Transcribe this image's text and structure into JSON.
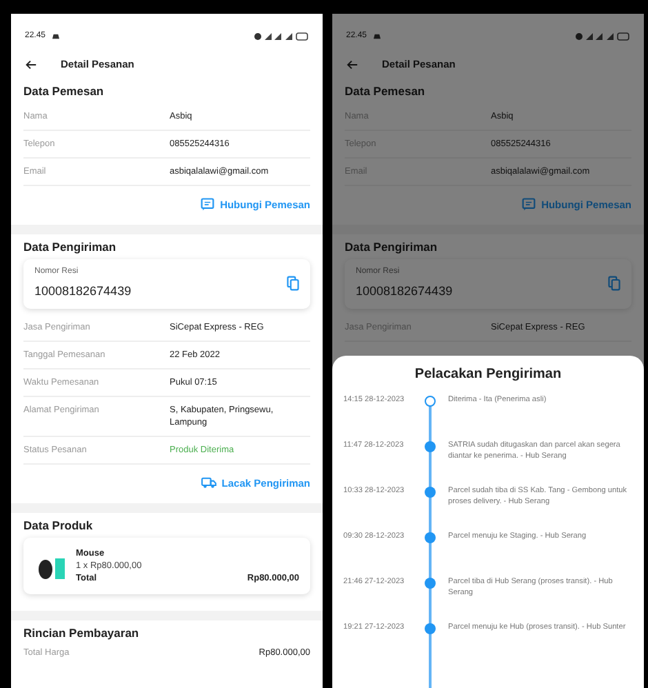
{
  "screens": [
    {
      "status_bar": {
        "time": "22.45"
      },
      "header": {
        "title": "Detail Pesanan"
      },
      "dimmed": false,
      "sections": [
        {
          "title": "Data Pemesan",
          "rows": [
            {
              "label": "Nama",
              "value": "Asbiq",
              "kind": "plain"
            },
            {
              "label": "Telepon",
              "value": "085525244316",
              "kind": "plain"
            },
            {
              "label": "Email",
              "value": "asbiqalalawi@gmail.com",
              "kind": "plain"
            }
          ],
          "action": {
            "label": "Hubungi Pemesan",
            "kind": "chat"
          }
        },
        {
          "title": "Data Pengiriman",
          "resi": {
            "label": "Nomor Resi",
            "value": "10008182674439"
          },
          "rows": [
            {
              "label": "Jasa Pengiriman",
              "value": "SiCepat Express - REG",
              "kind": "plain"
            },
            {
              "label": "Tanggal Pemesanan",
              "value": "22 Feb 2022",
              "kind": "plain"
            },
            {
              "label": "Waktu Pemesanan",
              "value": "Pukul 07:15",
              "kind": "plain"
            },
            {
              "label": "Alamat Pengiriman",
              "value": "S, Kabupaten, Pringsewu, Lampung",
              "kind": "plain"
            },
            {
              "label": "Status Pesanan",
              "value": "Produk Diterima",
              "kind": "status"
            }
          ],
          "action": {
            "label": "Lacak Pengiriman",
            "kind": "truck"
          }
        },
        {
          "title": "Data Produk",
          "product": {
            "name": "Mouse",
            "qty": "1 x Rp80.000,00",
            "total_label": "Total",
            "total": "Rp80.000,00"
          }
        },
        {
          "title": "Rincian Pembayaran",
          "rows": [
            {
              "label": "Total Harga",
              "value": "Rp80.000,00",
              "kind": "amount"
            }
          ]
        }
      ]
    },
    {
      "status_bar": {
        "time": "22.45"
      },
      "header": {
        "title": "Detail Pesanan"
      },
      "dimmed": true,
      "sections": [
        {
          "title": "Data Pemesan",
          "rows": [
            {
              "label": "Nama",
              "value": "Asbiq",
              "kind": "plain"
            },
            {
              "label": "Telepon",
              "value": "085525244316",
              "kind": "plain"
            },
            {
              "label": "Email",
              "value": "asbiqalalawi@gmail.com",
              "kind": "plain"
            }
          ],
          "action": {
            "label": "Hubungi Pemesan",
            "kind": "chat"
          }
        },
        {
          "title": "Data Pengiriman",
          "resi": {
            "label": "Nomor Resi",
            "value": "10008182674439"
          },
          "rows": [
            {
              "label": "Jasa Pengiriman",
              "value": "SiCepat Express - REG",
              "kind": "plain"
            }
          ]
        }
      ],
      "sheet": {
        "title": "Pelacakan Pengiriman",
        "events": [
          {
            "time": "14:15 28-12-2023",
            "text": "Diterima - Ita (Penerima asli)",
            "current": true
          },
          {
            "time": "11:47 28-12-2023",
            "text": "SATRIA sudah ditugaskan dan parcel akan segera diantar ke penerima. - Hub Serang",
            "current": false
          },
          {
            "time": "10:33 28-12-2023",
            "text": "Parcel sudah tiba di SS Kab. Tang - Gembong untuk proses delivery. - Hub Serang",
            "current": false
          },
          {
            "time": "09:30 28-12-2023",
            "text": "Parcel menuju ke Staging. - Hub Serang",
            "current": false
          },
          {
            "time": "21:46 27-12-2023",
            "text": "Parcel tiba di Hub Serang (proses transit). - Hub Serang",
            "current": false
          },
          {
            "time": "19:21 27-12-2023",
            "text": "Parcel menuju ke Hub (proses transit). - Hub Sunter",
            "current": false
          }
        ]
      }
    }
  ]
}
